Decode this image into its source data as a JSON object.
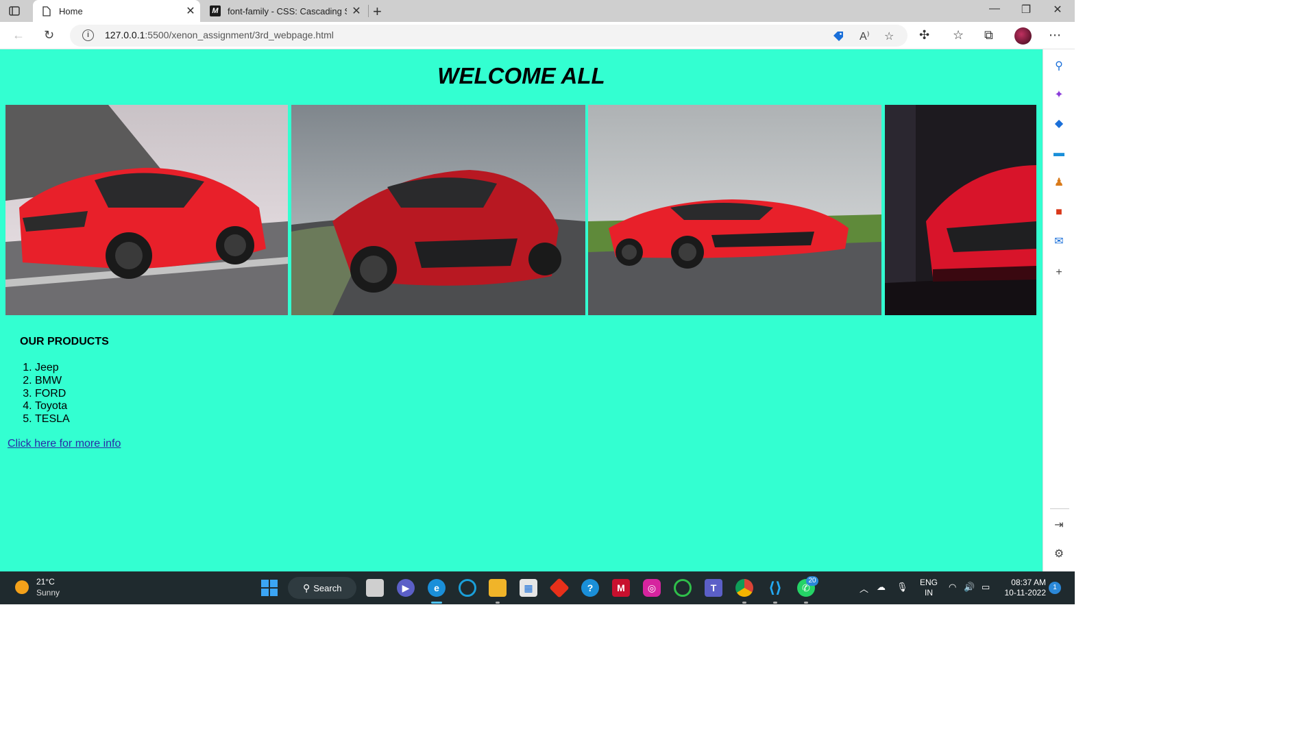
{
  "browser": {
    "tabs": [
      {
        "label": "Home",
        "active": true
      },
      {
        "label": "font-family - CSS: Cascading Styl",
        "active": false
      }
    ],
    "mdn_glyph": "M",
    "url_host": "127.0.0.1",
    "url_path": ":5500/xenon_assignment/3rd_webpage.html",
    "info_glyph": "i"
  },
  "page": {
    "title": "WELCOME ALL",
    "background": "#33ffd1",
    "gallery": [
      {
        "name": "red-corvette-rear",
        "body_color": "#e8202a"
      },
      {
        "name": "red-corvette-front-track",
        "body_color": "#b81822"
      },
      {
        "name": "red-corvette-side-track",
        "body_color": "#e8202a"
      },
      {
        "name": "red-corvette-studio",
        "body_color": "#d8142a"
      }
    ],
    "products_title": "OUR PRODUCTS",
    "products": [
      "Jeep",
      "BMW",
      "FORD",
      "Toyota",
      "TESLA"
    ],
    "more_link": "Click here for more info"
  },
  "taskbar": {
    "weather_temp": "21°C",
    "weather_condition": "Sunny",
    "search_label": "Search",
    "whatsapp_badge": "20",
    "lang_top": "ENG",
    "lang_bottom": "IN",
    "time": "08:37 AM",
    "date": "10-11-2022",
    "notification_count": "1"
  }
}
